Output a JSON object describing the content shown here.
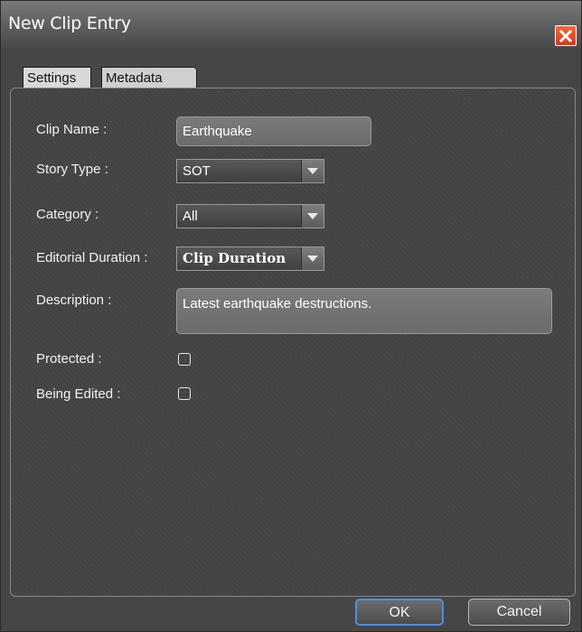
{
  "window": {
    "title": "New Clip Entry"
  },
  "tabs": [
    {
      "label": "Settings"
    },
    {
      "label": "Metadata"
    }
  ],
  "form": {
    "clip_name": {
      "label": "Clip Name :",
      "value": "Earthquake"
    },
    "story_type": {
      "label": "Story Type :",
      "value": "SOT"
    },
    "category": {
      "label": "Category :",
      "value": "All"
    },
    "editorial_duration": {
      "label": "Editorial Duration :",
      "value": "Clip Duration"
    },
    "description": {
      "label": "Description :",
      "value": "Latest earthquake destructions."
    },
    "protected": {
      "label": "Protected :",
      "checked": false
    },
    "being_edited": {
      "label": "Being Edited :",
      "checked": false
    }
  },
  "buttons": {
    "ok": "OK",
    "cancel": "Cancel"
  },
  "colors": {
    "accent": "#4a90e2",
    "close": "#e0461f"
  },
  "icons": {
    "close": "close-icon",
    "dropdown": "chevron-down-icon"
  }
}
